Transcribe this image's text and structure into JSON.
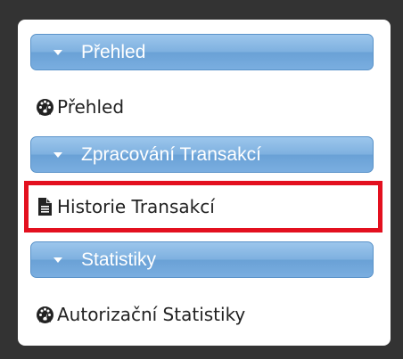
{
  "sidebar": {
    "sections": [
      {
        "header": "Přehled",
        "items": [
          {
            "label": "Přehled",
            "icon": "dashboard-icon"
          }
        ]
      },
      {
        "header": "Zpracování Transakcí",
        "items": [
          {
            "label": "Historie Transakcí",
            "icon": "document-icon",
            "highlighted": true
          }
        ]
      },
      {
        "header": "Statistiky",
        "items": [
          {
            "label": "Autorizační Statistiky",
            "icon": "dashboard-icon"
          }
        ]
      }
    ]
  },
  "colors": {
    "page_background": "#333333",
    "panel_background": "#ffffff",
    "header_gradient_top": "#9cc6ec",
    "header_gradient_bottom": "#6aa1d6",
    "header_text": "#ffffff",
    "item_text": "#222222",
    "highlight_border": "#e3101f"
  }
}
